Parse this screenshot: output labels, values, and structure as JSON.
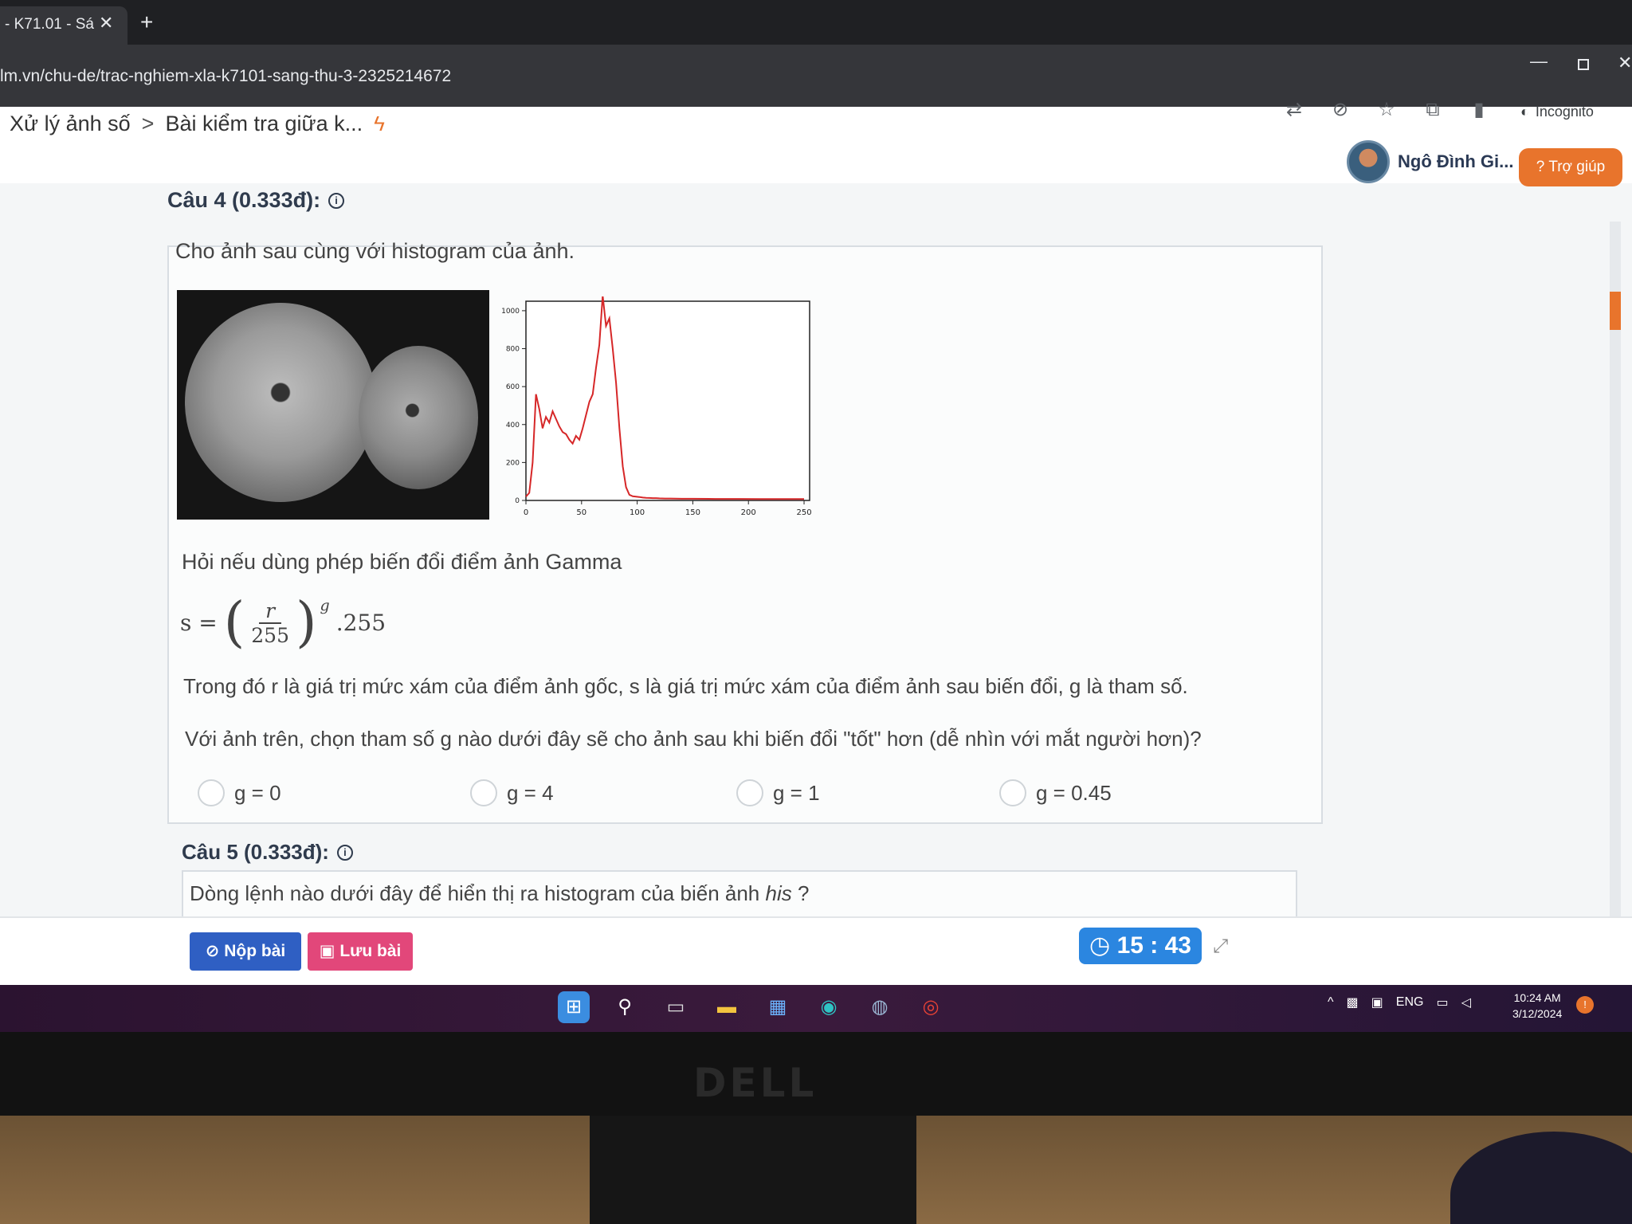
{
  "browser": {
    "tab_title": "- K71.01 - Sá",
    "tab_close": "✕",
    "new_tab": "+",
    "url": "lm.vn/chu-de/trac-nghiem-xla-k7101-sang-thu-3-2325214672",
    "incognito_label": "Incognito"
  },
  "header": {
    "breadcrumb": [
      "Xử lý ảnh số",
      "Bài kiểm tra giữa k..."
    ],
    "breadcrumb_sep": ">",
    "user_name": "Ngô Đình Gi...",
    "help_label": "Trợ giúp"
  },
  "q4": {
    "heading": "Câu 4 (0.333đ):",
    "intro": "Cho ảnh sau cùng với histogram của ảnh.",
    "question": "Hỏi nếu dùng phép biến đổi điểm ảnh Gamma",
    "formula": {
      "lhs": "s =",
      "num": "r",
      "den": "255",
      "exp": "g",
      "tail": ".255"
    },
    "explanation": "Trong đó r là giá trị mức xám của điểm ảnh gốc, s là giá trị mức xám của điểm ảnh sau biến đổi, g là tham số.",
    "prompt": "Với ảnh trên, chọn tham số g nào dưới đây sẽ cho ảnh sau khi biến đổi \"tốt\" hơn (dễ nhìn với mắt người hơn)?",
    "options": [
      "g = 0",
      "g = 4",
      "g = 1",
      "g = 0.45"
    ]
  },
  "q5": {
    "heading": "Câu 5 (0.333đ):",
    "text_start": "Dòng lệnh nào dưới đây để hiển thị ra histogram của biến ảnh ",
    "text_var": "his",
    "text_end": " ?"
  },
  "actions": {
    "submit_label": "Nộp bài",
    "save_label": "Lưu bài",
    "timer": "15 : 43"
  },
  "taskbar": {
    "lang": "ENG",
    "time": "10:24 AM",
    "date": "3/12/2024"
  },
  "monitor_brand": "DELL",
  "chart_data": {
    "type": "line",
    "xlim": [
      0,
      255
    ],
    "ylim": [
      0,
      1050
    ],
    "xticks": [
      0,
      50,
      100,
      150,
      200,
      250
    ],
    "yticks": [
      0,
      200,
      400,
      600,
      800,
      1000
    ],
    "color": "#d62728",
    "x": [
      0,
      3,
      6,
      9,
      12,
      15,
      18,
      21,
      24,
      27,
      30,
      33,
      36,
      39,
      42,
      45,
      48,
      51,
      54,
      57,
      60,
      63,
      66,
      69,
      72,
      75,
      78,
      81,
      84,
      87,
      90,
      93,
      96,
      99,
      102,
      105,
      108,
      111,
      114,
      117,
      120,
      125,
      130,
      140,
      150,
      170,
      190,
      210,
      230,
      250
    ],
    "y": [
      20,
      40,
      200,
      560,
      480,
      380,
      440,
      410,
      470,
      430,
      390,
      360,
      350,
      320,
      300,
      340,
      320,
      380,
      450,
      520,
      560,
      700,
      820,
      1080,
      920,
      960,
      800,
      620,
      380,
      180,
      70,
      30,
      22,
      20,
      18,
      15,
      14,
      13,
      12,
      12,
      11,
      10,
      10,
      9,
      9,
      8,
      8,
      7,
      7,
      7
    ]
  }
}
